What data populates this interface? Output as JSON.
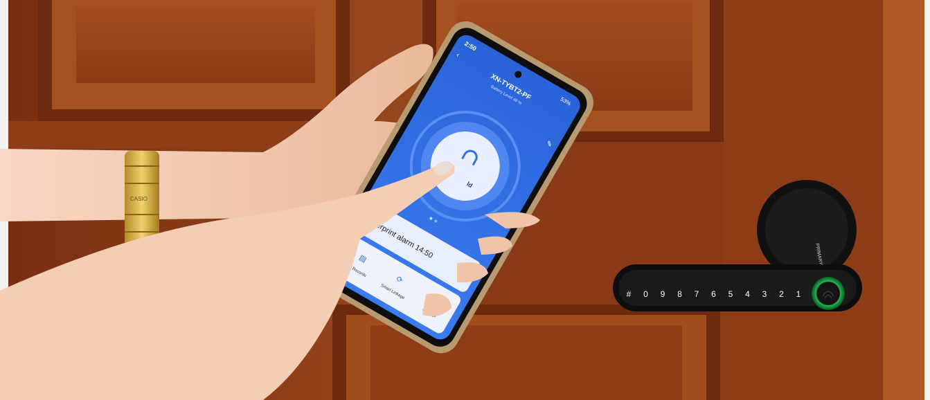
{
  "phone": {
    "status_time": "2:50",
    "status_battery": "53%",
    "device_name": "XN-TYBT2-PF",
    "device_subtitle": "Battery Level 48 %",
    "unlock_label": "ld",
    "notification_text": "ingerprint alarm 14:50",
    "nav": [
      {
        "label": "ord Records"
      },
      {
        "label": "Smart Linkage"
      },
      {
        "label": "Settings"
      }
    ]
  },
  "lock": {
    "keypad": [
      "#",
      "0",
      "9",
      "8",
      "7",
      "6",
      "5",
      "4",
      "3",
      "2",
      "1"
    ],
    "brand": "PRIMARY",
    "fingerprint_ring_color": "#2fe06a"
  },
  "watch": {
    "brand": "CASIO"
  },
  "colors": {
    "door": "#8a3a16",
    "app_blue": "#2f6fe0",
    "skin": "#f0c4a8"
  }
}
